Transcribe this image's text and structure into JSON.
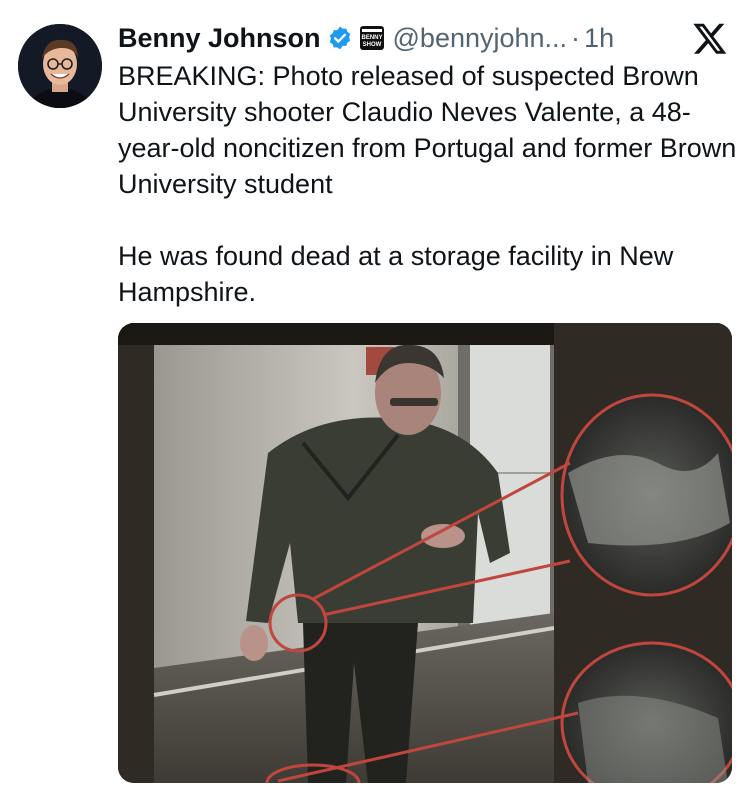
{
  "tweet": {
    "author_name": "Benny Johnson",
    "handle": "@bennyjohn...",
    "separator": "·",
    "time": "1h",
    "affiliation_badge_text": "BENNY SHOW",
    "paragraphs": [
      "BREAKING: Photo released of suspected Brown University shooter Claudio Neves Valente, a 48-year-old noncitizen from Portugal and former Brown University student",
      "He was found dead at a storage facility in New Hampshire."
    ]
  },
  "icons": {
    "verified": "verified-badge-icon",
    "affiliation": "affiliate-logo-icon",
    "platform": "x-logo-icon"
  },
  "colors": {
    "verified_blue": "#1d9bf0",
    "text_primary": "#0f1419",
    "text_secondary": "#536471",
    "highlight_circle": "#c0463e"
  }
}
